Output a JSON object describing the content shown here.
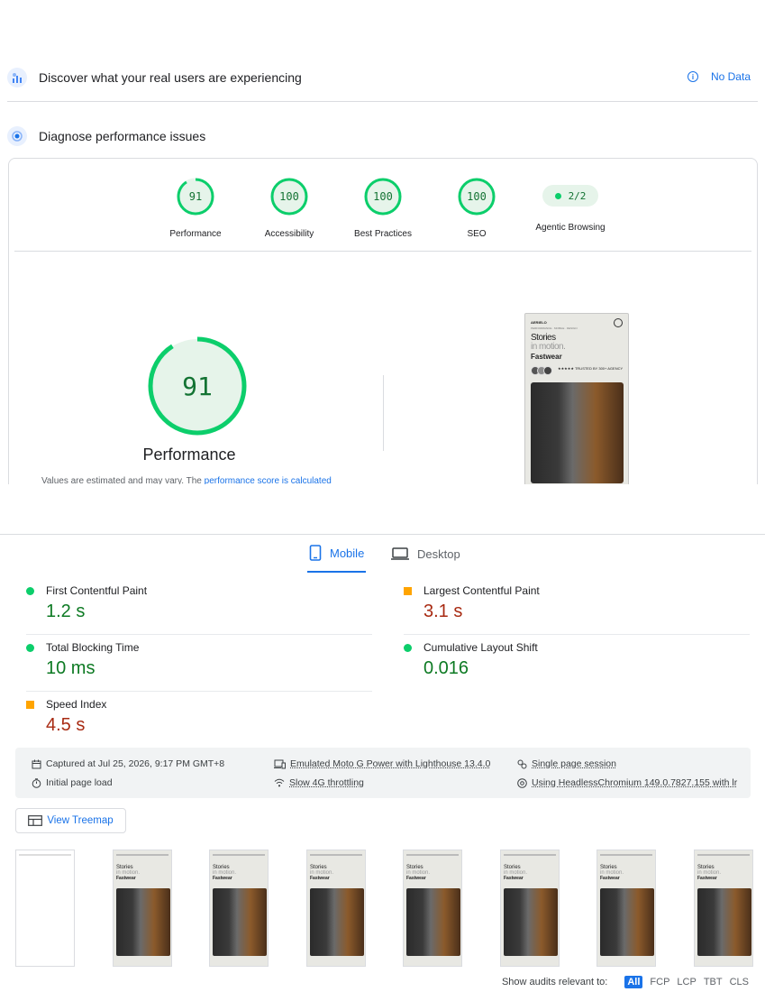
{
  "field": {
    "title": "Discover what your real users are experiencing",
    "no_data": "No Data"
  },
  "lab": {
    "title": "Diagnose performance issues"
  },
  "categories": [
    {
      "label": "Performance",
      "score": "91",
      "value": 91
    },
    {
      "label": "Accessibility",
      "score": "100",
      "value": 100
    },
    {
      "label": "Best Practices",
      "score": "100",
      "value": 100
    },
    {
      "label": "SEO",
      "score": "100",
      "value": 100
    },
    {
      "label": "Agentic Browsing",
      "score": "2/2"
    }
  ],
  "main_score": {
    "score": "91",
    "value": 91,
    "label": "Performance"
  },
  "estimate": {
    "prefix": "Values are estimated and may vary. The ",
    "link": "performance score is calculated"
  },
  "preview": {
    "brand": "AERIELO",
    "tagline": "PERFORMANCE · MOBILE · DESIGN",
    "line1": "Stories",
    "line2": "in motion.",
    "line3": "Fastwear",
    "stars": "★★★★★ TRUSTED BY 300+ AGENCY"
  },
  "tabs": [
    {
      "label": "Mobile",
      "active": true
    },
    {
      "label": "Desktop",
      "active": false
    }
  ],
  "metrics": [
    {
      "label": "First Contentful Paint",
      "value": "1.2 s",
      "status": "good"
    },
    {
      "label": "Largest Contentful Paint",
      "value": "3.1 s",
      "status": "average"
    },
    {
      "label": "Total Blocking Time",
      "value": "10 ms",
      "status": "good"
    },
    {
      "label": "Cumulative Layout Shift",
      "value": "0.016",
      "status": "good"
    },
    {
      "label": "Speed Index",
      "value": "4.5 s",
      "status": "average"
    }
  ],
  "environment": {
    "captured": "Captured at Jul 25, 2026, 9:17 PM GMT+8",
    "initial": "Initial page load",
    "device": "Emulated Moto G Power with Lighthouse 13.4.0",
    "throttling": "Slow 4G throttling",
    "session": "Single page session",
    "browser": "Using HeadlessChromium 149.0.7827.155 with lr"
  },
  "treemap_label": "View Treemap",
  "filmstrip_count": 8,
  "audit_filter": {
    "label": "Show audits relevant to:",
    "options": [
      "All",
      "FCP",
      "LCP",
      "TBT",
      "CLS"
    ]
  },
  "colors": {
    "good": "#0cce6b",
    "average": "#ffa400",
    "accent": "#1a73e8"
  }
}
